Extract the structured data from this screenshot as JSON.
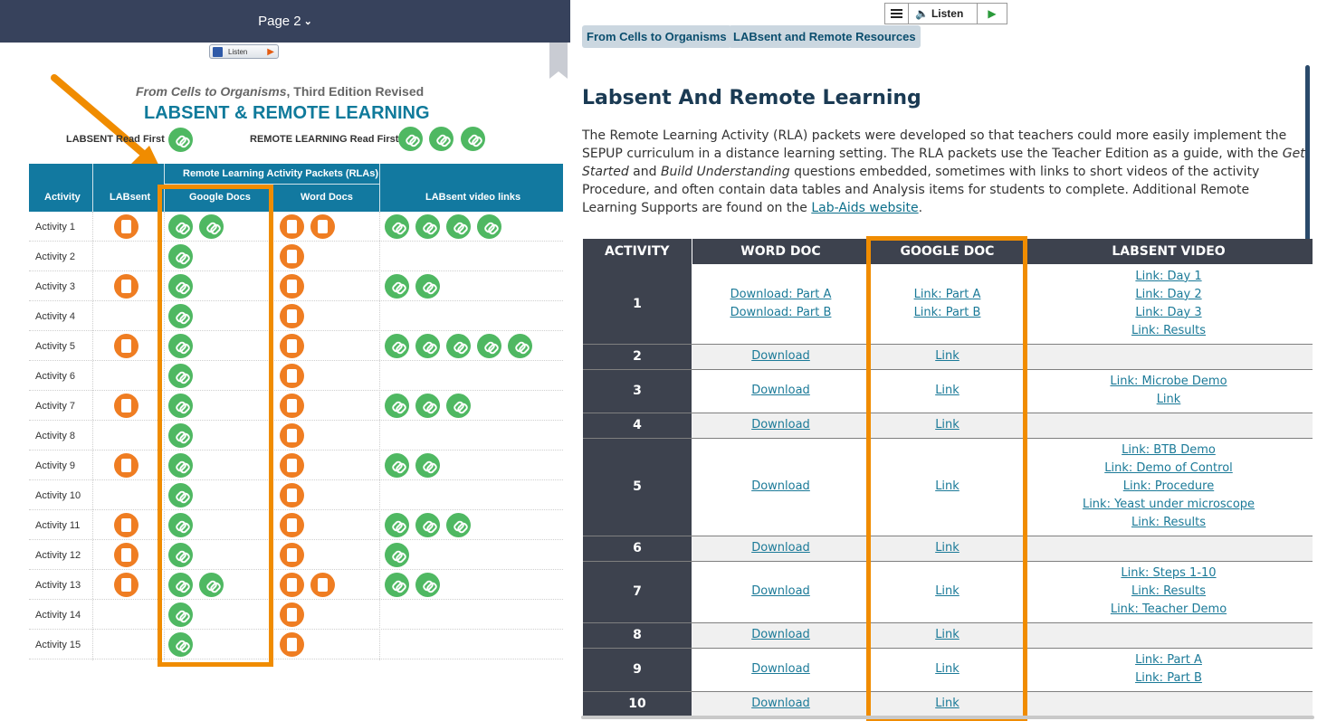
{
  "left": {
    "page_label": "Page 2",
    "mini_listen": "Listen",
    "doc_subtitle_italic": "From Cells to Organisms",
    "doc_subtitle_rest": ", Third Edition Revised",
    "doc_title": "LABSENT & REMOTE LEARNING",
    "labsent_read_first": "LABSENT Read First",
    "remote_read_first": "REMOTE LEARNING Read First",
    "header_group": "Remote Learning Activity Packets (RLAs)",
    "headers": [
      "Activity",
      "LABsent",
      "Google Docs",
      "Word Docs",
      "LABsent video links"
    ],
    "rows": [
      {
        "activity": "Activity 1",
        "labsent": 1,
        "google": 2,
        "word": 2,
        "video": 4
      },
      {
        "activity": "Activity 2",
        "labsent": 0,
        "google": 1,
        "word": 1,
        "video": 0
      },
      {
        "activity": "Activity 3",
        "labsent": 1,
        "google": 1,
        "word": 1,
        "video": 2
      },
      {
        "activity": "Activity 4",
        "labsent": 0,
        "google": 1,
        "word": 1,
        "video": 0
      },
      {
        "activity": "Activity 5",
        "labsent": 1,
        "google": 1,
        "word": 1,
        "video": 5
      },
      {
        "activity": "Activity 6",
        "labsent": 0,
        "google": 1,
        "word": 1,
        "video": 0
      },
      {
        "activity": "Activity 7",
        "labsent": 1,
        "google": 1,
        "word": 1,
        "video": 3
      },
      {
        "activity": "Activity 8",
        "labsent": 0,
        "google": 1,
        "word": 1,
        "video": 0
      },
      {
        "activity": "Activity 9",
        "labsent": 1,
        "google": 1,
        "word": 1,
        "video": 2
      },
      {
        "activity": "Activity 10",
        "labsent": 0,
        "google": 1,
        "word": 1,
        "video": 0
      },
      {
        "activity": "Activity 11",
        "labsent": 1,
        "google": 1,
        "word": 1,
        "video": 3
      },
      {
        "activity": "Activity 12",
        "labsent": 1,
        "google": 1,
        "word": 1,
        "video": 1
      },
      {
        "activity": "Activity 13",
        "labsent": 1,
        "google": 2,
        "word": 2,
        "video": 2
      },
      {
        "activity": "Activity 14",
        "labsent": 0,
        "google": 1,
        "word": 1,
        "video": 0
      },
      {
        "activity": "Activity 15",
        "labsent": 0,
        "google": 1,
        "word": 1,
        "video": 0
      }
    ],
    "colors": {
      "bar": "#37425c",
      "header": "#1279a0",
      "link_icon": "#4fb862",
      "doc_icon": "#ef7d22",
      "highlight": "#f08c00"
    }
  },
  "right": {
    "listen_label": "Listen",
    "breadcrumbs": [
      "From Cells to Organisms",
      "LABsent and Remote Resources"
    ],
    "title": "Labsent And Remote Learning",
    "para_1": "The Remote Learning Activity (RLA) packets were developed so that teachers could more easily implement the SEPUP curriculum in a distance learning setting. The RLA packets use the Teacher Edition as a guide, with the ",
    "para_em_1": "Get Started",
    "para_2": " and ",
    "para_em_2": "Build Understanding",
    "para_3": " questions embedded, sometimes with links to short videos of the activity Procedure, and often contain data tables and Analysis items for students to complete. Additional Remote Learning Supports are found on the ",
    "para_link": "Lab-Aids website",
    "para_end": ".",
    "headers": [
      "ACTIVITY",
      "WORD DOC",
      "GOOGLE DOC",
      "LABSENT VIDEO"
    ],
    "rows": [
      {
        "num": "1",
        "word": [
          "Download: Part A",
          "Download: Part B"
        ],
        "google": [
          "Link: Part A",
          "Link: Part B"
        ],
        "video": [
          "Link: Day 1",
          "Link: Day 2",
          "Link: Day 3",
          "Link: Results"
        ]
      },
      {
        "num": "2",
        "word": [
          "Download"
        ],
        "google": [
          "Link"
        ],
        "video": []
      },
      {
        "num": "3",
        "word": [
          "Download"
        ],
        "google": [
          "Link"
        ],
        "video": [
          "Link: Microbe Demo",
          "Link"
        ]
      },
      {
        "num": "4",
        "word": [
          "Download"
        ],
        "google": [
          "Link"
        ],
        "video": []
      },
      {
        "num": "5",
        "word": [
          "Download"
        ],
        "google": [
          "Link"
        ],
        "video": [
          "Link: BTB Demo",
          "Link: Demo of Control",
          "Link: Procedure",
          "Link: Yeast under microscope",
          "Link: Results"
        ]
      },
      {
        "num": "6",
        "word": [
          "Download"
        ],
        "google": [
          "Link"
        ],
        "video": []
      },
      {
        "num": "7",
        "word": [
          "Download"
        ],
        "google": [
          "Link"
        ],
        "video": [
          "Link: Steps 1-10",
          "Link: Results",
          "Link: Teacher Demo"
        ]
      },
      {
        "num": "8",
        "word": [
          "Download"
        ],
        "google": [
          "Link"
        ],
        "video": []
      },
      {
        "num": "9",
        "word": [
          "Download"
        ],
        "google": [
          "Link"
        ],
        "video": [
          "Link: Part A",
          "Link: Part B"
        ]
      },
      {
        "num": "10",
        "word": [
          "Download"
        ],
        "google": [
          "Link"
        ],
        "video": []
      }
    ],
    "colors": {
      "title": "#1a3a53",
      "link": "#1b7a98",
      "header_bg": "#3d424e",
      "crumb_bg": "#cbd7e0"
    }
  }
}
